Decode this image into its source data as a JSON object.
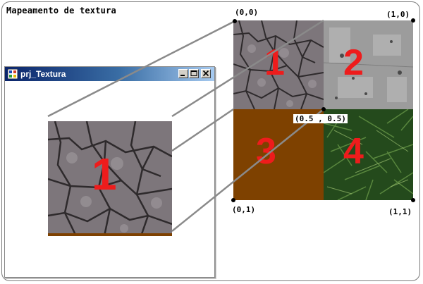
{
  "page": {
    "title": "Mapeamento de textura"
  },
  "window": {
    "title": "prj_Textura",
    "texture_label": "1",
    "icons": [
      "app-icon",
      "minimize-icon",
      "maximize-icon",
      "close-icon"
    ]
  },
  "texture_map": {
    "quadrants": [
      {
        "label": "1",
        "texture": "cracked-ground",
        "color": "#7d767b"
      },
      {
        "label": "2",
        "texture": "concrete",
        "color": "#9c9c9c"
      },
      {
        "label": "3",
        "texture": "solid-brown",
        "color": "#7e4100"
      },
      {
        "label": "4",
        "texture": "grass",
        "color": "#244a1c"
      }
    ],
    "coords": {
      "top_left": "(0,0)",
      "top_right": "(1,0)",
      "center": "(0.5 , 0.5)",
      "bottom_left": "(0,1)",
      "bottom_right": "(1,1)"
    }
  },
  "colors": {
    "accent": "#ee1c1c",
    "titlebar": "#0a246a",
    "brown": "#7e4100"
  }
}
